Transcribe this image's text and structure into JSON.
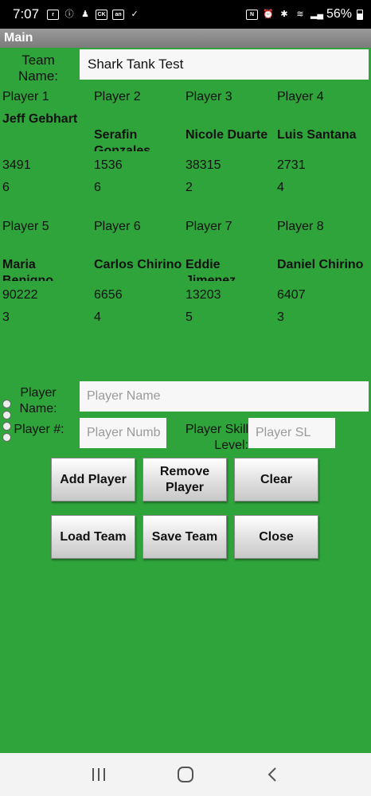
{
  "status": {
    "time": "7:07",
    "battery": "56%"
  },
  "title_bar": "Main",
  "team": {
    "label": "Team Name:",
    "value": "Shark Tank Test"
  },
  "players_top": [
    {
      "header": "Player 1",
      "name": "Jeff Gebhart",
      "number": "3491",
      "skill": "6"
    },
    {
      "header": "Player 2",
      "name": "Serafin Gonzales",
      "number": "1536",
      "skill": "6"
    },
    {
      "header": "Player 3",
      "name": "Nicole Duarte",
      "number": "38315",
      "skill": "2"
    },
    {
      "header": "Player 4",
      "name": "Luis Santana",
      "number": "2731",
      "skill": "4"
    }
  ],
  "players_bottom": [
    {
      "header": "Player 5",
      "name": "Maria Benigno",
      "number": "90222",
      "skill": "3"
    },
    {
      "header": "Player 6",
      "name": "Carlos Chirino",
      "number": "6656",
      "skill": "4"
    },
    {
      "header": "Player 7",
      "name": "Eddie Jimenez",
      "number": "13203",
      "skill": "5"
    },
    {
      "header": "Player 8",
      "name": "Daniel Chirino",
      "number": "6407",
      "skill": "3"
    }
  ],
  "form": {
    "player_name_label": "Player Name:",
    "player_name_placeholder": "Player Name",
    "player_num_label": "Player #:",
    "player_num_placeholder": "Player Numb",
    "skill_label": "Player Skill Level:",
    "skill_placeholder": "Player SL"
  },
  "buttons": {
    "add_player": "Add Player",
    "remove_player": "Remove Player",
    "clear": "Clear",
    "load_team": "Load Team",
    "save_team": "Save Team",
    "close": "Close"
  },
  "icons": [
    "ring-icon",
    "info-icon",
    "person-icon",
    "cc-icon",
    "app-icon",
    "check-icon",
    "nfc-icon",
    "alarm-icon",
    "bluetooth-icon",
    "wifi-icon",
    "signal-icon",
    "battery-icon",
    "recent-apps-icon",
    "home-icon",
    "back-icon"
  ]
}
